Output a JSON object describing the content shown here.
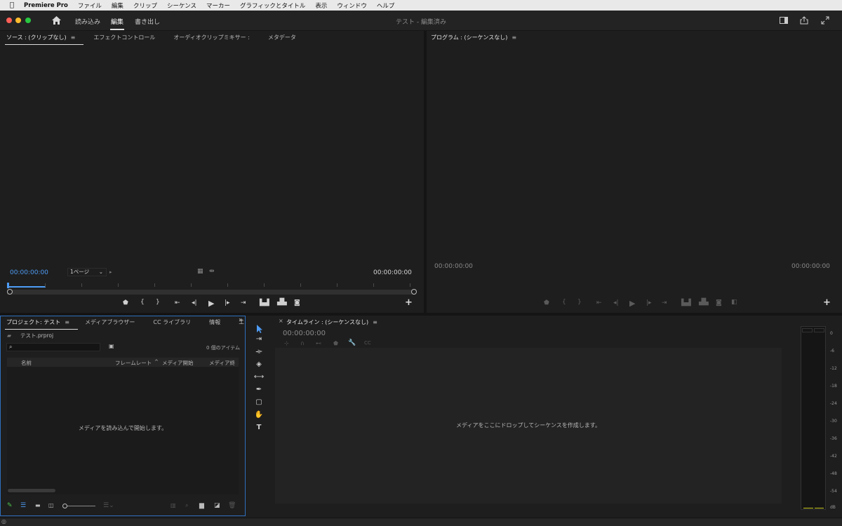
{
  "menubar": {
    "app_name": "Premiere Pro",
    "items": [
      "ファイル",
      "編集",
      "クリップ",
      "シーケンス",
      "マーカー",
      "グラフィックとタイトル",
      "表示",
      "ウィンドウ",
      "ヘルプ"
    ]
  },
  "titlebar": {
    "tabs": [
      "読み込み",
      "編集",
      "書き出し"
    ],
    "active_tab": "編集",
    "window_title": "テスト - 編集済み"
  },
  "source_panel": {
    "tabs": [
      "ソース : (クリップなし)",
      "エフェクトコントロール",
      "オーディオクリップミキサー :",
      "メタデータ"
    ],
    "menu_glyph": "≡",
    "timecode_in": "00:00:00:00",
    "timecode_out": "00:00:00:00",
    "page_select": "1ページ",
    "add_label": "+"
  },
  "program_panel": {
    "title": "プログラム : (シーケンスなし)",
    "menu_glyph": "≡",
    "timecode_in": "00:00:00:00",
    "timecode_out": "00:00:00:00",
    "add_label": "+"
  },
  "project_panel": {
    "tabs": [
      "プロジェクト: テスト",
      "メディアブラウザー",
      "CC ライブラリ",
      "情報",
      "エ"
    ],
    "menu_glyph": "≡",
    "overflow_glyph": "»",
    "project_file": "テスト.prproj",
    "item_count": "0 個のアイテム",
    "columns": [
      "名前",
      "フレームレート",
      "メディア開始",
      "メディア終了"
    ],
    "empty_message": "メディアを読み込んで開始します。"
  },
  "timeline_panel": {
    "close_glyph": "×",
    "title": "タイムライン : (シーケンスなし)",
    "menu_glyph": "≡",
    "timecode": "00:00:00:00",
    "empty_message": "メディアをここにドロップしてシーケンスを作成します。"
  },
  "audio_meter": {
    "scale": [
      "0",
      "-6",
      "-12",
      "-18",
      "-24",
      "-30",
      "-36",
      "-42",
      "-48",
      "-54",
      "dB"
    ]
  },
  "icons": {
    "tool_type": "T",
    "colors": {
      "accent_blue": "#4e9cf5",
      "selection_border": "#2f6fbf",
      "meter_level": "#c8c820"
    }
  }
}
